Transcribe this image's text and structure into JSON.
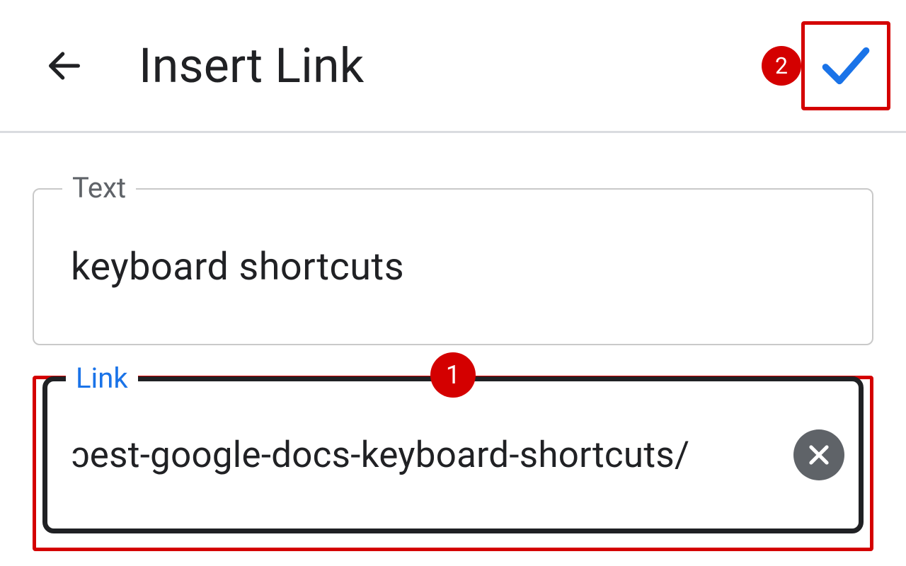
{
  "header": {
    "title": "Insert Link"
  },
  "fields": {
    "text": {
      "label": "Text",
      "value": "keyboard shortcuts"
    },
    "link": {
      "label": "Link",
      "value": "ɔest-google-docs-keyboard-shortcuts/"
    }
  },
  "annotations": {
    "badge1": "1",
    "badge2": "2"
  },
  "colors": {
    "highlight": "#d40000",
    "check": "#1a73e8"
  }
}
